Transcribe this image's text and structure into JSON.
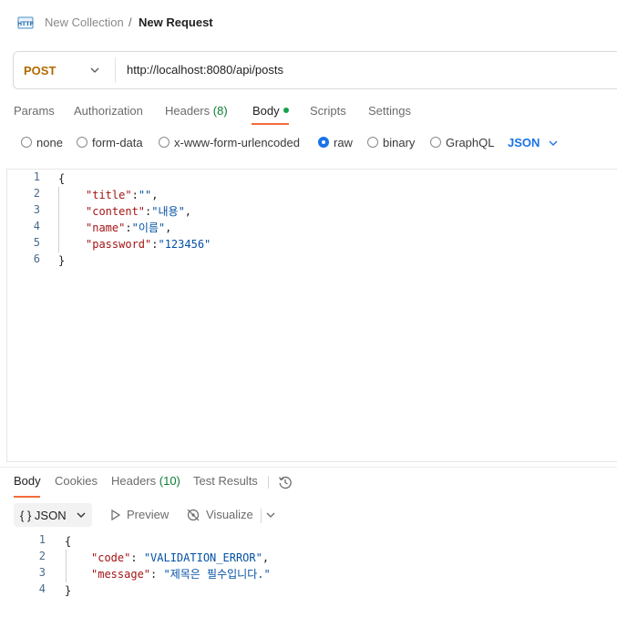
{
  "breadcrumb": {
    "icon": "http-icon",
    "collection": "New Collection",
    "separator": "/",
    "request": "New Request"
  },
  "urlbar": {
    "method": "POST",
    "url": "http://localhost:8080/api/posts"
  },
  "request_tabs": [
    {
      "label": "Params"
    },
    {
      "label": "Authorization"
    },
    {
      "label": "Headers",
      "count": "(8)"
    },
    {
      "label": "Body",
      "active": true
    },
    {
      "label": "Scripts"
    },
    {
      "label": "Settings"
    }
  ],
  "body_types": [
    {
      "label": "none",
      "checked": false
    },
    {
      "label": "form-data",
      "checked": false
    },
    {
      "label": "x-www-form-urlencoded",
      "checked": false
    },
    {
      "label": "raw",
      "checked": true
    },
    {
      "label": "binary",
      "checked": false
    },
    {
      "label": "GraphQL",
      "checked": false
    }
  ],
  "language": "JSON",
  "request_body": {
    "line_numbers": [
      "1",
      "2",
      "3",
      "4",
      "5",
      "6"
    ],
    "lines": [
      {
        "text": "{"
      },
      {
        "key": "\"title\"",
        "value": "\"\""
      },
      {
        "key": "\"content\"",
        "value": "\"내용\""
      },
      {
        "key": "\"name\"",
        "value": "\"이름\""
      },
      {
        "key": "\"password\"",
        "value": "\"123456\""
      },
      {
        "text": "}"
      }
    ]
  },
  "response_tabs": [
    {
      "label": "Body",
      "active": true
    },
    {
      "label": "Cookies"
    },
    {
      "label": "Headers",
      "count": "(10)"
    },
    {
      "label": "Test Results"
    }
  ],
  "response_toolbar": {
    "format_label": "{ } JSON",
    "preview_label": "Preview",
    "visualize_label": "Visualize"
  },
  "response_body": {
    "line_numbers": [
      "1",
      "2",
      "3",
      "4"
    ],
    "lines": [
      {
        "text": "{"
      },
      {
        "key": "\"code\"",
        "value": "\"VALIDATION_ERROR\""
      },
      {
        "key": "\"message\"",
        "value": "\"제목은 필수입니다.\""
      },
      {
        "text": "}"
      }
    ]
  },
  "colors": {
    "method": "#b06a00",
    "active_tab_underline": "#f26b3a",
    "body_dot": "#15a24a",
    "radio_checked": "#1a73e8",
    "json_key": "#a31515",
    "json_string": "#0451a5"
  }
}
